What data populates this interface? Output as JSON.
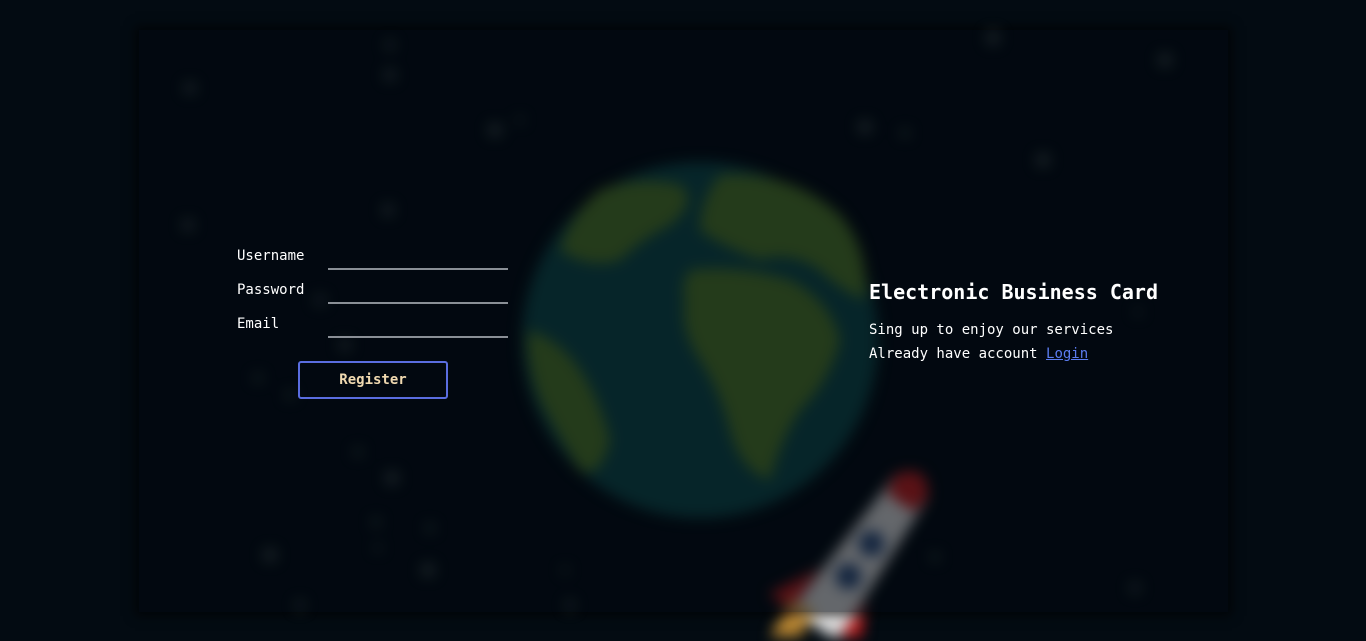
{
  "form": {
    "fields": [
      {
        "label": "Username",
        "value": "",
        "placeholder": ""
      },
      {
        "label": "Password",
        "value": "",
        "placeholder": ""
      },
      {
        "label": "Email",
        "value": "",
        "placeholder": ""
      }
    ],
    "submit_label": "Register"
  },
  "info": {
    "title": "Electronic Business Card",
    "signup_text": "Sing up to enjoy our services",
    "login_prompt": "Already have account",
    "login_link": "Login"
  },
  "colors": {
    "background": "#030b12",
    "button_border": "#5a6de0",
    "button_text": "#f0d9b0",
    "link": "#5b7cf0",
    "input_underline": "#8a8f96"
  },
  "icons": [
    "earth-illustration",
    "rocket-illustration",
    "star-dots"
  ]
}
